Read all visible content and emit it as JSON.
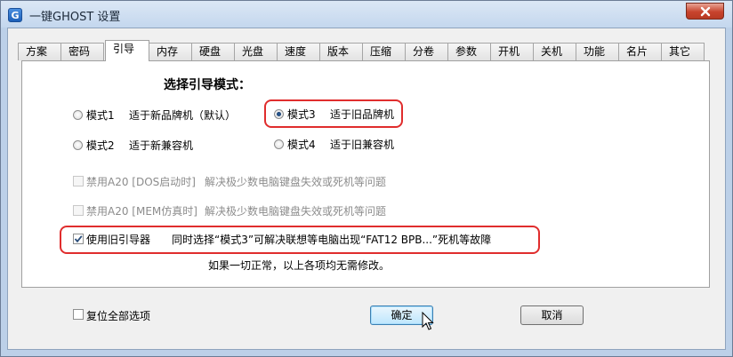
{
  "window": {
    "title": "一键GHOST 设置",
    "app_icon_letter": "G"
  },
  "tabs": [
    {
      "label": "方案"
    },
    {
      "label": "密码"
    },
    {
      "label": "引导",
      "active": true
    },
    {
      "label": "内存"
    },
    {
      "label": "硬盘"
    },
    {
      "label": "光盘"
    },
    {
      "label": "速度"
    },
    {
      "label": "版本"
    },
    {
      "label": "压缩"
    },
    {
      "label": "分卷"
    },
    {
      "label": "参数"
    },
    {
      "label": "开机"
    },
    {
      "label": "关机"
    },
    {
      "label": "功能"
    },
    {
      "label": "名片"
    },
    {
      "label": "其它"
    }
  ],
  "boot": {
    "heading": "选择引导模式：",
    "modes": [
      {
        "label": "模式1",
        "desc": "适于新品牌机（默认）",
        "checked": false
      },
      {
        "label": "模式2",
        "desc": "适于新兼容机",
        "checked": false
      },
      {
        "label": "模式3",
        "desc": "适于旧品牌机",
        "checked": true
      },
      {
        "label": "模式4",
        "desc": "适于旧兼容机",
        "checked": false
      }
    ],
    "options": [
      {
        "label": "禁用A20 [DOS启动时]",
        "desc": "解决极少数电脑键盘失效或死机等问题",
        "checked": false,
        "enabled": false
      },
      {
        "label": "禁用A20 [MEM仿真时]",
        "desc": "解决极少数电脑键盘失效或死机等问题",
        "checked": false,
        "enabled": false
      },
      {
        "label": "使用旧引导器",
        "desc": "同时选择“模式3”可解决联想等电脑出现“FAT12 BPB...”死机等故障",
        "checked": true,
        "enabled": true
      }
    ],
    "note": "如果一切正常，以上各项均无需修改。"
  },
  "footer": {
    "reset_label": "复位全部选项",
    "reset_checked": false,
    "ok_label": "确定",
    "cancel_label": "取消"
  },
  "colors": {
    "highlight": "#e02d2d",
    "title_bar": "#c4d7ee"
  }
}
